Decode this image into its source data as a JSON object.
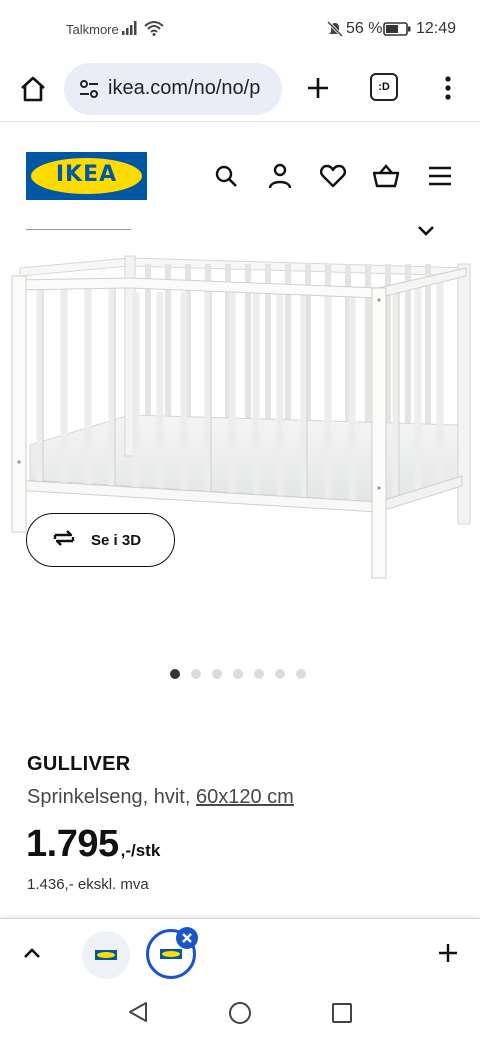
{
  "status_bar": {
    "carrier": "Talkmore",
    "battery_percent": "56 %",
    "time": "12:49"
  },
  "browser": {
    "url": "ikea.com/no/no/p",
    "tabs_label": ":D"
  },
  "site": {
    "logo_text": "IKEA"
  },
  "product": {
    "view_3d_label": "Se i 3D",
    "image_count": 7,
    "active_image": 1,
    "name": "GULLIVER",
    "description": "Sprinkelseng, hvit,",
    "size": "60x120 cm",
    "price": "1.795",
    "price_suffix": ",-/stk",
    "price_ex_vat": "1.436,- ekskl. mva"
  },
  "colors": {
    "ikea_blue": "#0058a3",
    "ikea_yellow": "#ffdb00",
    "chrome_accent": "#1a56c8"
  }
}
